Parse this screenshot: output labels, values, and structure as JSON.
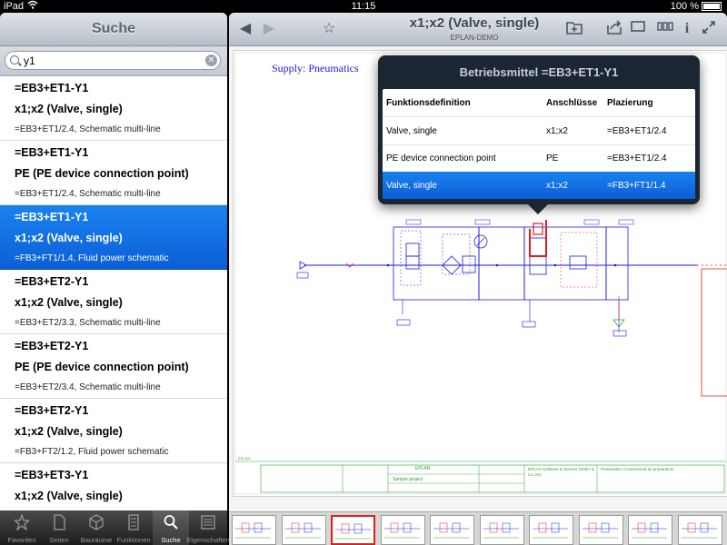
{
  "statusbar": {
    "device": "iPad",
    "time": "11:15",
    "battery": "100 %"
  },
  "search": {
    "title": "Suche",
    "query": "y1",
    "placeholder": ""
  },
  "results": [
    {
      "tag": "=EB3+ET1-Y1",
      "name": "x1;x2 (Valve, single)",
      "location": "=EB3+ET1/2.4, Schematic multi-line",
      "selected": false
    },
    {
      "tag": "=EB3+ET1-Y1",
      "name": "PE (PE device connection point)",
      "location": "=EB3+ET1/2.4, Schematic multi-line",
      "selected": false
    },
    {
      "tag": "=EB3+ET1-Y1",
      "name": "x1;x2 (Valve, single)",
      "location": "=FB3+FT1/1.4, Fluid power schematic",
      "selected": true
    },
    {
      "tag": "=EB3+ET2-Y1",
      "name": "x1;x2 (Valve, single)",
      "location": "=EB3+ET2/3.3, Schematic multi-line",
      "selected": false
    },
    {
      "tag": "=EB3+ET2-Y1",
      "name": "PE (PE device connection point)",
      "location": "=EB3+ET2/3.4, Schematic multi-line",
      "selected": false
    },
    {
      "tag": "=EB3+ET2-Y1",
      "name": "x1;x2 (Valve, single)",
      "location": "=FB3+FT2/1.2, Fluid power schematic",
      "selected": false
    },
    {
      "tag": "=EB3+ET3-Y1",
      "name": "x1;x2 (Valve, single)",
      "location": "",
      "selected": false
    }
  ],
  "tabs": [
    {
      "label": "Favoriten",
      "icon": "star-icon",
      "active": false
    },
    {
      "label": "Seiten",
      "icon": "page-icon",
      "active": false
    },
    {
      "label": "Bauräume",
      "icon": "cube-icon",
      "active": false
    },
    {
      "label": "Funktionen",
      "icon": "function-icon",
      "active": false
    },
    {
      "label": "Suche",
      "icon": "search-icon",
      "active": true
    },
    {
      "label": "Eigenschaften",
      "icon": "properties-icon",
      "active": false
    }
  ],
  "document": {
    "title": "x1;x2 (Valve, single)",
    "subtitle": "EPLAN-DEMO",
    "supply_label": "Supply: Pneumatics",
    "titleblock": {
      "company": "EPLAN Software & Service GmbH & Co. KG",
      "description": "Pneumatics Compressed air preparation",
      "project": "Sample project",
      "brand": "EPLAN"
    }
  },
  "popover": {
    "title": "Betriebsmittel =EB3+ET1-Y1",
    "columns": [
      "Funktionsdefinition",
      "Anschlüsse",
      "Plazierung"
    ],
    "rows": [
      {
        "definition": "Valve, single",
        "connections": "x1;x2",
        "placement": "=EB3+ET1/2.4",
        "selected": false
      },
      {
        "definition": "PE device connection point",
        "connections": "PE",
        "placement": "=EB3+ET1/2.4",
        "selected": false
      },
      {
        "definition": "Valve, single",
        "connections": "x1;x2",
        "placement": "=FB3+FT1/1.4",
        "selected": true
      }
    ]
  },
  "thumbnails": {
    "count": 10,
    "selected_index": 2
  },
  "colors": {
    "accent": "#0b6ee0",
    "schematic": "#1a1ae0",
    "highlight": "#e21b1b",
    "green": "#2ea02e"
  }
}
